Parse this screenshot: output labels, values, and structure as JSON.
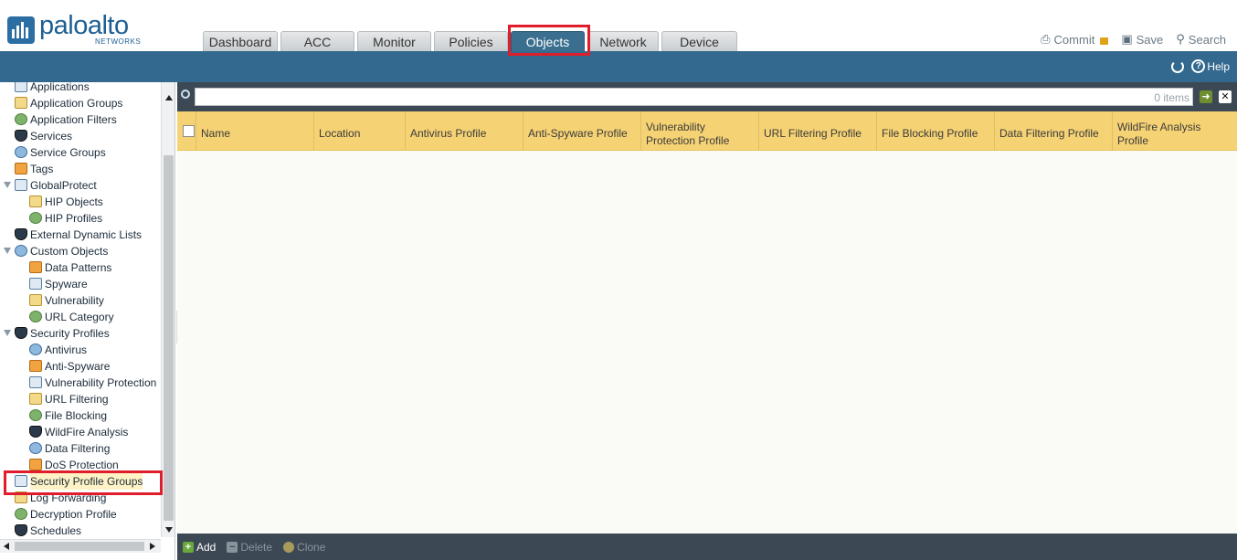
{
  "header": {
    "logo_text": "paloalto",
    "logo_sub": "NETWORKS",
    "tabs": [
      {
        "label": "Dashboard"
      },
      {
        "label": "ACC"
      },
      {
        "label": "Monitor"
      },
      {
        "label": "Policies"
      },
      {
        "label": "Objects",
        "active": true
      },
      {
        "label": "Network"
      },
      {
        "label": "Device"
      }
    ],
    "commit_label": "Commit",
    "save_label": "Save",
    "search_label": "Search"
  },
  "toolbar": {
    "help_label": "Help"
  },
  "sidebar": {
    "items": [
      {
        "label": "Applications",
        "level": 1,
        "icon": "application-icon"
      },
      {
        "label": "Application Groups",
        "level": 1,
        "icon": "application-groups-icon"
      },
      {
        "label": "Application Filters",
        "level": 1,
        "icon": "application-filters-icon"
      },
      {
        "label": "Services",
        "level": 1,
        "icon": "services-icon"
      },
      {
        "label": "Service Groups",
        "level": 1,
        "icon": "service-groups-icon"
      },
      {
        "label": "Tags",
        "level": 1,
        "icon": "tag-icon"
      },
      {
        "label": "GlobalProtect",
        "level": 0,
        "expandable": true,
        "icon": "globalprotect-icon"
      },
      {
        "label": "HIP Objects",
        "level": 2,
        "icon": "hip-objects-icon"
      },
      {
        "label": "HIP Profiles",
        "level": 2,
        "icon": "hip-profiles-icon"
      },
      {
        "label": "External Dynamic Lists",
        "level": 1,
        "icon": "external-dynamic-lists-icon"
      },
      {
        "label": "Custom Objects",
        "level": 0,
        "expandable": true,
        "icon": "custom-objects-icon"
      },
      {
        "label": "Data Patterns",
        "level": 2,
        "icon": "data-patterns-icon"
      },
      {
        "label": "Spyware",
        "level": 2,
        "icon": "spyware-icon"
      },
      {
        "label": "Vulnerability",
        "level": 2,
        "icon": "vulnerability-icon"
      },
      {
        "label": "URL Category",
        "level": 2,
        "icon": "url-category-icon"
      },
      {
        "label": "Security Profiles",
        "level": 0,
        "expandable": true,
        "icon": "security-profiles-icon"
      },
      {
        "label": "Antivirus",
        "level": 2,
        "icon": "antivirus-icon"
      },
      {
        "label": "Anti-Spyware",
        "level": 2,
        "icon": "anti-spyware-icon"
      },
      {
        "label": "Vulnerability Protection",
        "level": 2,
        "icon": "vulnerability-protection-icon"
      },
      {
        "label": "URL Filtering",
        "level": 2,
        "icon": "url-filtering-icon"
      },
      {
        "label": "File Blocking",
        "level": 2,
        "icon": "file-blocking-icon"
      },
      {
        "label": "WildFire Analysis",
        "level": 2,
        "icon": "wildfire-analysis-icon"
      },
      {
        "label": "Data Filtering",
        "level": 2,
        "icon": "data-filtering-icon"
      },
      {
        "label": "DoS Protection",
        "level": 2,
        "icon": "dos-protection-icon"
      },
      {
        "label": "Security Profile Groups",
        "level": 1,
        "selected": true,
        "icon": "security-profile-groups-icon"
      },
      {
        "label": "Log Forwarding",
        "level": 1,
        "icon": "log-forwarding-icon"
      },
      {
        "label": "Decryption Profile",
        "level": 1,
        "icon": "decryption-profile-icon"
      },
      {
        "label": "Schedules",
        "level": 1,
        "icon": "schedules-icon"
      }
    ]
  },
  "filter": {
    "placeholder": "",
    "count": "0 items"
  },
  "table": {
    "columns": [
      {
        "label": "Name"
      },
      {
        "label": "Location"
      },
      {
        "label": "Antivirus Profile"
      },
      {
        "label": "Anti-Spyware Profile"
      },
      {
        "label": "Vulnerability Protection Profile"
      },
      {
        "label": "URL Filtering Profile"
      },
      {
        "label": "File Blocking Profile"
      },
      {
        "label": "Data Filtering Profile"
      },
      {
        "label": "WildFire Analysis Profile"
      }
    ],
    "rows": []
  },
  "actions": {
    "add_label": "Add",
    "delete_label": "Delete",
    "clone_label": "Clone"
  },
  "colors": {
    "nav_bar": "#33698e",
    "active_tab": "#3a6f8f",
    "grid_header": "#f5d274",
    "highlight": "#e01d2a"
  }
}
